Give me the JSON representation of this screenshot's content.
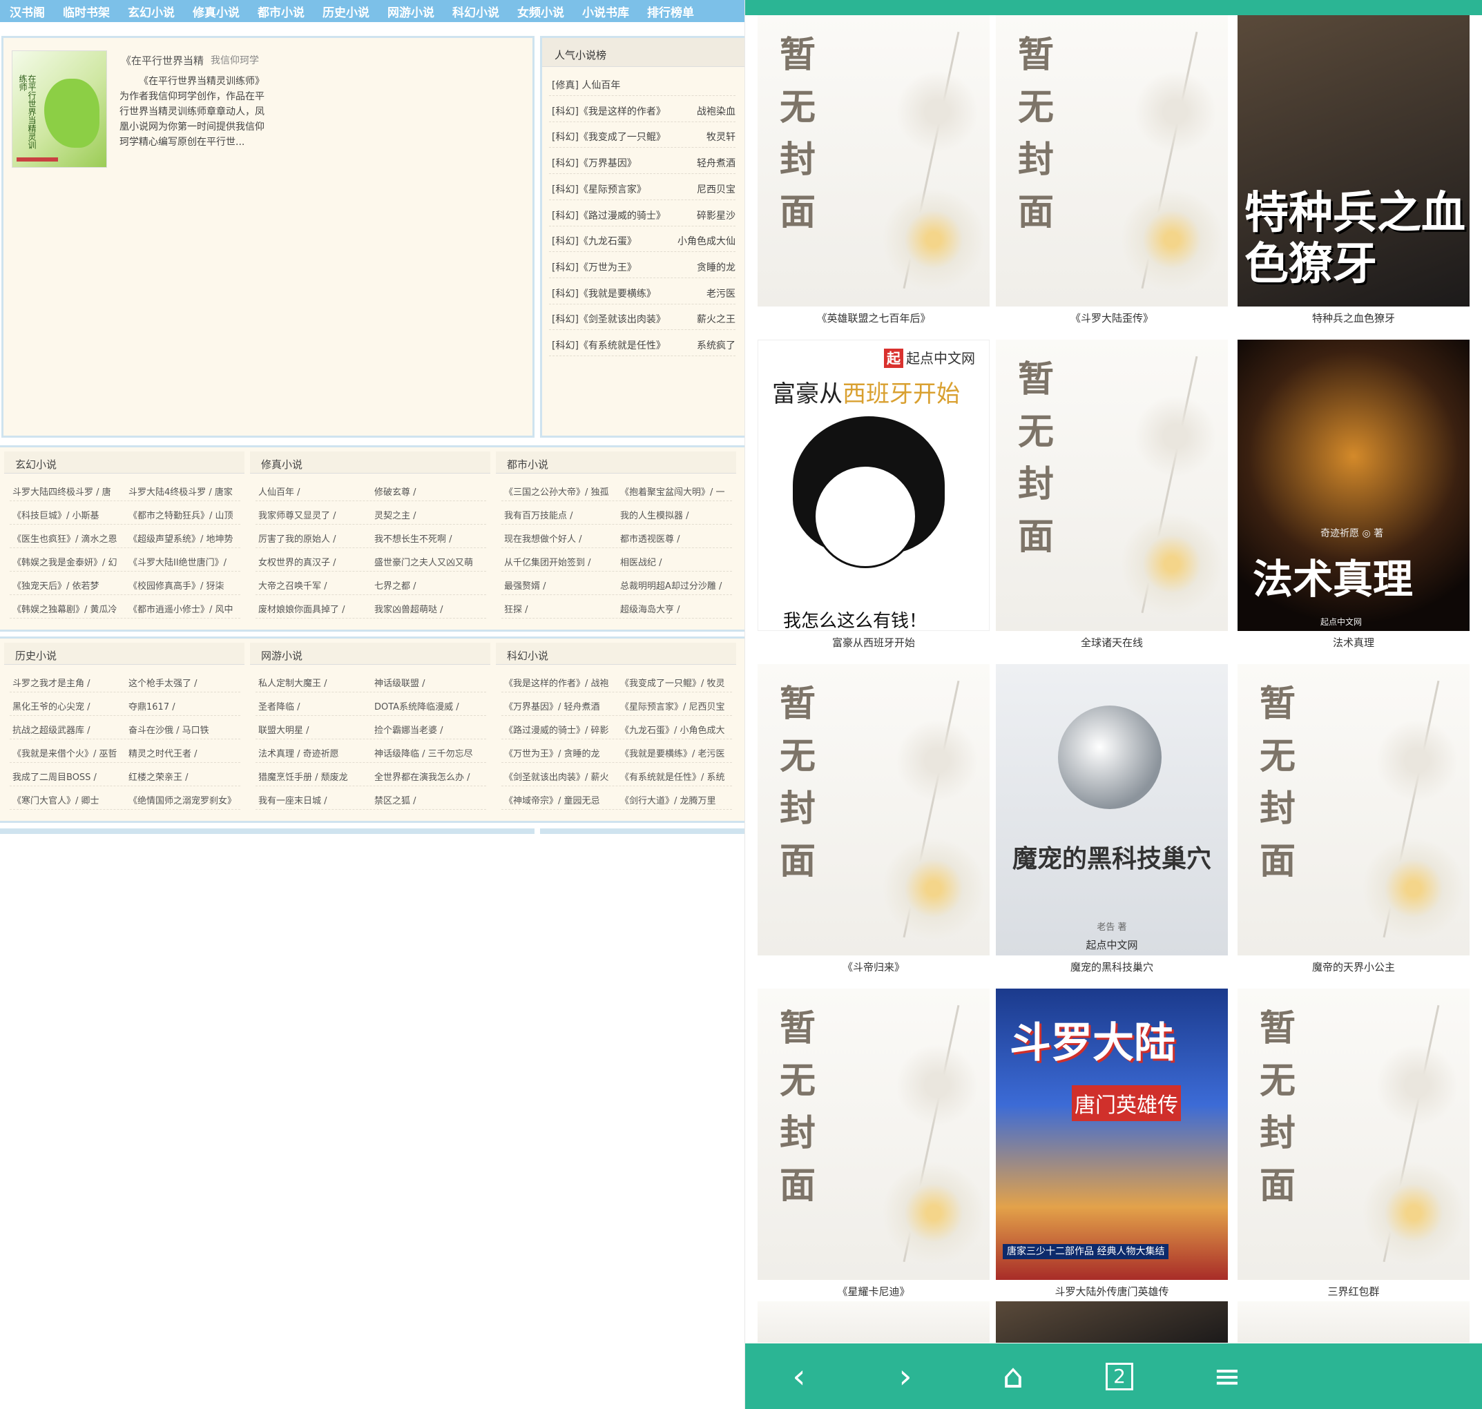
{
  "nav": [
    "汉书阁",
    "临时书架",
    "玄幻小说",
    "修真小说",
    "都市小说",
    "历史小说",
    "网游小说",
    "科幻小说",
    "女频小说",
    "小说书库",
    "排行榜单"
  ],
  "featured": {
    "title": "《在平行世界当精",
    "author": "我信仰珂学",
    "description": "《在平行世界当精灵训练师》为作者我信仰珂学创作，作品在平行世界当精灵训练师章章动人，凤凰小说网为你第一时间提供我信仰珂学精心编写原创在平行世...",
    "cover_text": "在平行世界当精灵训练师"
  },
  "hot": {
    "title": "人气小说榜",
    "items": [
      {
        "t": "[修真] 人仙百年",
        "a": ""
      },
      {
        "t": "[科幻]《我是这样的作者》",
        "a": "战袍染血"
      },
      {
        "t": "[科幻]《我变成了一只鲲》",
        "a": "牧灵轩"
      },
      {
        "t": "[科幻]《万界基因》",
        "a": "轻舟煮酒"
      },
      {
        "t": "[科幻]《星际预言家》",
        "a": "尼西贝宝"
      },
      {
        "t": "[科幻]《路过漫威的骑士》",
        "a": "碎影星沙"
      },
      {
        "t": "[科幻]《九龙石蛋》",
        "a": "小角色成大仙"
      },
      {
        "t": "[科幻]《万世为王》",
        "a": "贪睡的龙"
      },
      {
        "t": "[科幻]《我就是要横练》",
        "a": "老污医"
      },
      {
        "t": "[科幻]《剑圣就该出肉装》",
        "a": "薪火之王"
      },
      {
        "t": "[科幻]《有系统就是任性》",
        "a": "系统疯了"
      }
    ]
  },
  "sections1": [
    {
      "title": "玄幻小说",
      "rows": [
        [
          "斗罗大陆四终极斗罗 / 唐",
          "斗罗大陆4终极斗罗 / 唐家"
        ],
        [
          "《科技巨城》/ 小斯基",
          "《都市之特勤狂兵》/ 山顶"
        ],
        [
          "《医生也疯狂》/ 滴水之恩",
          "《超级声望系统》/ 地坤势"
        ],
        [
          "《韩娱之我是金泰妍》/ 幻",
          "《斗罗大陆II绝世唐门》/"
        ],
        [
          "《独宠天后》/ 依若梦",
          "《校园修真高手》/ 犽柒"
        ],
        [
          "《韩娱之独幕剧》/ 黄瓜冷",
          "《都市逍遥小修士》/ 风中"
        ]
      ]
    },
    {
      "title": "修真小说",
      "rows": [
        [
          "人仙百年 /",
          "修破玄尊 /"
        ],
        [
          "我家师尊又显灵了 /",
          "灵契之主 /"
        ],
        [
          "厉害了我的原始人 /",
          "我不想长生不死啊 /"
        ],
        [
          "女权世界的真汉子 /",
          "盛世豪门之夫人又凶又萌"
        ],
        [
          "大帝之召唤千军 /",
          "七界之都 /"
        ],
        [
          "废材娘娘你面具掉了 /",
          "我家凶兽超萌哒 /"
        ]
      ]
    },
    {
      "title": "都市小说",
      "rows": [
        [
          "《三国之公孙大帝》/ 独孤",
          "《抱着聚宝盆闯大明》/ 一"
        ],
        [
          "我有百万技能点 /",
          "我的人生模拟器 /"
        ],
        [
          "现在我想做个好人 /",
          "都市透视医尊 /"
        ],
        [
          "从千亿集团开始签到 /",
          "相医战纪 /"
        ],
        [
          "最强赘婿 /",
          "总裁明明超A却过分沙雕 /"
        ],
        [
          "狂探 /",
          "超级海岛大亨 /"
        ]
      ]
    }
  ],
  "sections2": [
    {
      "title": "历史小说",
      "rows": [
        [
          "斗罗之我才是主角 /",
          "这个枪手太强了 /"
        ],
        [
          "黑化王爷的心尖宠 /",
          "夺鼎1617 /"
        ],
        [
          "抗战之超级武器库 /",
          "奋斗在沙俄 / 马口铁"
        ],
        [
          "《我就是来借个火》/ 巫哲",
          "精灵之时代王者 /"
        ],
        [
          "我成了二周目BOSS /",
          "红楼之荣亲王 /"
        ],
        [
          "《寒门大官人》/ 卿士",
          "《绝情国师之溺宠罗刹女》"
        ]
      ]
    },
    {
      "title": "网游小说",
      "rows": [
        [
          "私人定制大魔王 /",
          "神话级联盟 /"
        ],
        [
          "圣者降临 /",
          "DOTA系统降临漫威 /"
        ],
        [
          "联盟大明星 /",
          "捡个霸娜当老婆 /"
        ],
        [
          "法术真理 / 奇迹祈愿",
          "神话级降临 / 三千勿忘尽"
        ],
        [
          "猎魔烹饪手册 / 颓废龙",
          "全世界都在演我怎么办 /"
        ],
        [
          "我有一座末日城 /",
          "禁区之狐 /"
        ]
      ]
    },
    {
      "title": "科幻小说",
      "rows": [
        [
          "《我是这样的作者》/ 战袍",
          "《我变成了一只鲲》/ 牧灵"
        ],
        [
          "《万界基因》/ 轻舟煮酒",
          "《星际预言家》/ 尼西贝宝"
        ],
        [
          "《路过漫威的骑士》/ 碎影",
          "《九龙石蛋》/ 小角色成大"
        ],
        [
          "《万世为王》/ 贪睡的龙",
          "《我就是要横练》/ 老污医"
        ],
        [
          "《剑圣就该出肉装》/ 薪火",
          "《有系统就是任性》/ 系统"
        ],
        [
          "《神域帝宗》/ 童园无忌",
          "《剑行大道》/ 龙腾万里"
        ]
      ]
    }
  ],
  "placeholder_text": "暂无封面",
  "cards": [
    {
      "caption": "《英雄联盟之七百年后》",
      "type": "ph"
    },
    {
      "caption": "《斗罗大陆歪传》",
      "type": "ph"
    },
    {
      "caption": "特种兵之血色獠牙",
      "type": "dark1",
      "cover_text": "特种兵之血色獠牙"
    },
    {
      "caption": "富豪从西班牙开始",
      "type": "white1",
      "logo": "起点中文网",
      "logo_mark": "起",
      "t1": "富豪从",
      "t2": "西班牙开始",
      "t3": "我怎么这么有钱！"
    },
    {
      "caption": "全球诸天在线",
      "type": "ph"
    },
    {
      "caption": "法术真理",
      "type": "dark2",
      "au": "奇迹祈愿 ◎ 著",
      "t": "法术真理",
      "pub": "起点中文网"
    },
    {
      "caption": "《斗帝归来》",
      "type": "ph"
    },
    {
      "caption": "魔宠的黑科技巢穴",
      "type": "grey1",
      "t": "魔宠的黑科技巢穴",
      "a": "老告 著",
      "p": "起点中文网"
    },
    {
      "caption": "魔帝的天界小公主",
      "type": "ph"
    },
    {
      "caption": "《星耀卡尼迪》",
      "type": "ph"
    },
    {
      "caption": "斗罗大陆外传唐门英雄传",
      "type": "color1",
      "t": "斗罗大陆",
      "sub": "唐门英雄传",
      "bot": "唐家三少十二部作品 经典人物大集结"
    },
    {
      "caption": "三界红包群",
      "type": "ph"
    }
  ],
  "bottom_nav": [
    {
      "name": "back",
      "glyph": "‹"
    },
    {
      "name": "forward",
      "glyph": "›"
    },
    {
      "name": "home",
      "glyph": "⌂"
    },
    {
      "name": "tabs",
      "glyph": "2"
    },
    {
      "name": "menu",
      "glyph": "≡"
    }
  ],
  "colors": {
    "nav": "#7cc0e8",
    "panel": "#fdf8ec",
    "border": "#cfe3ef",
    "app_bar": "#2bb594"
  }
}
